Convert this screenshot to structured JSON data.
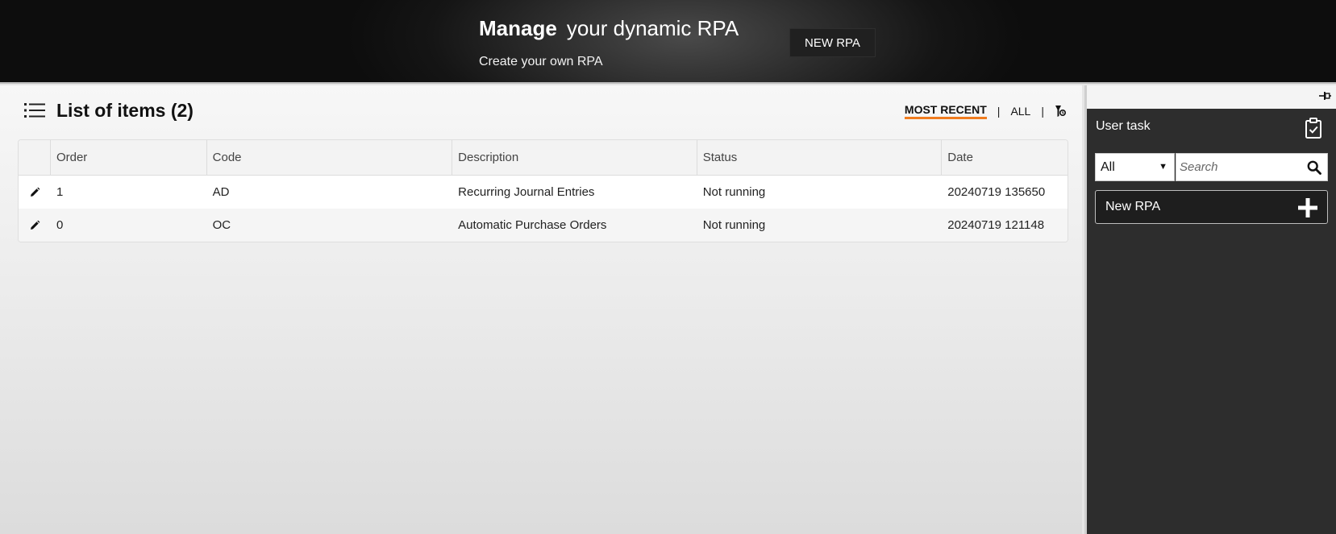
{
  "header": {
    "title_bold": "Manage",
    "title_light": "your dynamic RPA",
    "subtitle": "Create your own RPA",
    "new_button": "NEW RPA"
  },
  "list": {
    "title": "List of items (2)",
    "filters": {
      "most_recent": "MOST RECENT",
      "all": "ALL",
      "separator": "|"
    },
    "columns": [
      "Order",
      "Code",
      "Description",
      "Status",
      "Date"
    ],
    "rows": [
      {
        "order": "1",
        "code": "AD",
        "description": "Recurring Journal Entries",
        "status": "Not running",
        "date": "20240719 135650"
      },
      {
        "order": "0",
        "code": "OC",
        "description": "Automatic Purchase Orders",
        "status": "Not running",
        "date": "20240719 121148"
      }
    ]
  },
  "sidebar": {
    "title": "User task",
    "select_value": "All",
    "search_placeholder": "Search",
    "task_label": "New RPA"
  },
  "colors": {
    "accent": "#f07c1f",
    "header_bg": "#1a1a1a",
    "sidebar_bg": "#2d2d2d"
  },
  "icons": [
    "list-icon",
    "filter-icon",
    "edit-icon",
    "pin-icon",
    "clipboard-check-icon",
    "search-icon",
    "plus-icon"
  ]
}
